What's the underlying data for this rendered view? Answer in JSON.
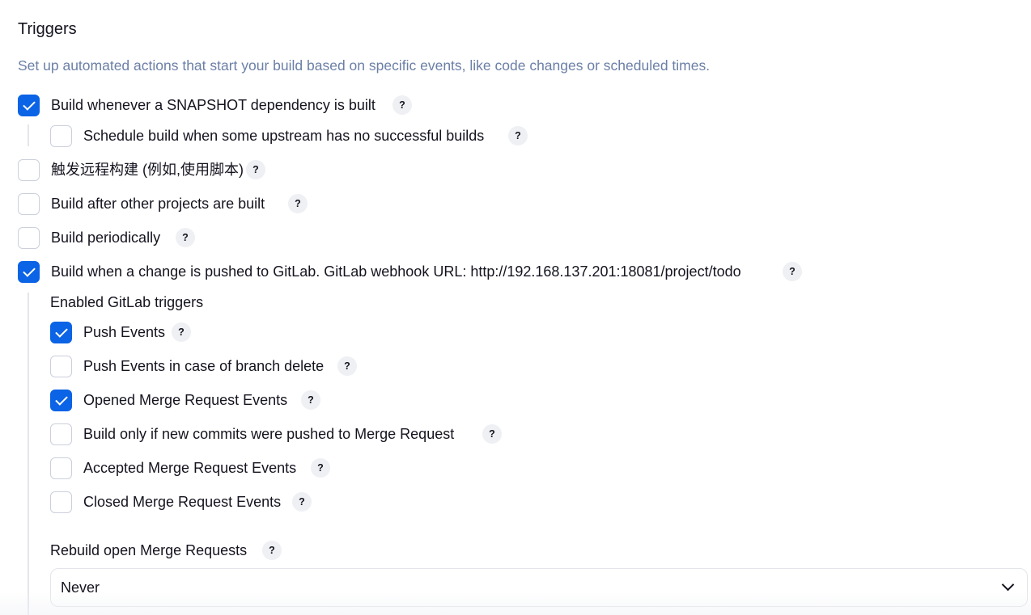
{
  "section": {
    "title": "Triggers",
    "description": "Set up automated actions that start your build based on specific events, like code changes or scheduled times."
  },
  "help_icon": {
    "name": "help-icon",
    "glyph": "?"
  },
  "accent_color": "#0b63e5",
  "triggers": {
    "snapshot": {
      "label": "Build whenever a SNAPSHOT dependency is built",
      "checked": true
    },
    "schedule_upstream": {
      "label": "Schedule build when some upstream has no successful builds",
      "checked": false
    },
    "remote": {
      "label": "触发远程构建 (例如,使用脚本)",
      "checked": false
    },
    "after_other": {
      "label": "Build after other projects are built",
      "checked": false
    },
    "periodically": {
      "label": "Build periodically",
      "checked": false
    },
    "gitlab": {
      "label": "Build when a change is pushed to GitLab. GitLab webhook URL: http://192.168.137.201:18081/project/todo",
      "checked": true
    }
  },
  "gitlab": {
    "enabled_title": "Enabled GitLab triggers",
    "push_events": {
      "label": "Push Events",
      "checked": true
    },
    "push_branch_delete": {
      "label": "Push Events in case of branch delete",
      "checked": false
    },
    "opened_mr": {
      "label": "Opened Merge Request Events",
      "checked": true
    },
    "new_commits_mr": {
      "label": "Build only if new commits were pushed to Merge Request",
      "checked": false
    },
    "accepted_mr": {
      "label": "Accepted Merge Request Events",
      "checked": false
    },
    "closed_mr": {
      "label": "Closed Merge Request Events",
      "checked": false
    },
    "rebuild": {
      "label": "Rebuild open Merge Requests",
      "selected": "Never"
    }
  }
}
